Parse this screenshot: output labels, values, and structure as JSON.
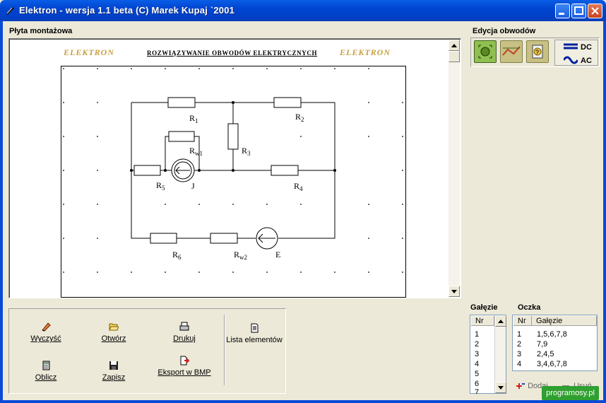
{
  "window": {
    "title": "Elektron - wersja 1.1 beta  (C) Marek Kupaj  `2001"
  },
  "board": {
    "label": "Płyta montażowa",
    "brand_left": "ELEKTRON",
    "brand_right": "ELEKTRON",
    "heading": "ROZWIĄZYWANIE OBWODÓW ELEKTRYCZNYCH",
    "elements": {
      "r1": "R",
      "r1_sub": "1",
      "r2": "R",
      "r2_sub": "2",
      "r3": "R",
      "r3_sub": "3",
      "r4": "R",
      "r4_sub": "4",
      "r5": "R",
      "r5_sub": "5",
      "r6": "R",
      "r6_sub": "6",
      "rw1": "R",
      "rw1_sub": "w1",
      "rw2": "R",
      "rw2_sub": "w2",
      "j": "J",
      "e": "E"
    }
  },
  "circuit_edit": {
    "label": "Edycja obwodów",
    "dc": "DC",
    "ac": "AC"
  },
  "actions": {
    "clear": "Wyczyść",
    "open": "Otwórz",
    "print": "Drukuj",
    "list": "Lista elementów",
    "calculate": "Oblicz",
    "save": "Zapisz",
    "export": "Eksport w BMP"
  },
  "branches": {
    "label": "Gałęzie",
    "header": "Nr",
    "rows": [
      "1",
      "2",
      "3",
      "4",
      "5",
      "6",
      "7"
    ]
  },
  "loops": {
    "label": "Oczka",
    "header_nr": "Nr",
    "header_branches": "Gałęzie",
    "rows": [
      {
        "nr": "1",
        "branches": "1,5,6,7,8"
      },
      {
        "nr": "2",
        "branches": "7,9"
      },
      {
        "nr": "3",
        "branches": "2,4,5"
      },
      {
        "nr": "4",
        "branches": "3,4,6,7,8"
      }
    ]
  },
  "footer": {
    "add": "Dodaj",
    "remove": "Usuń",
    "watermark": "programosy.pl"
  }
}
